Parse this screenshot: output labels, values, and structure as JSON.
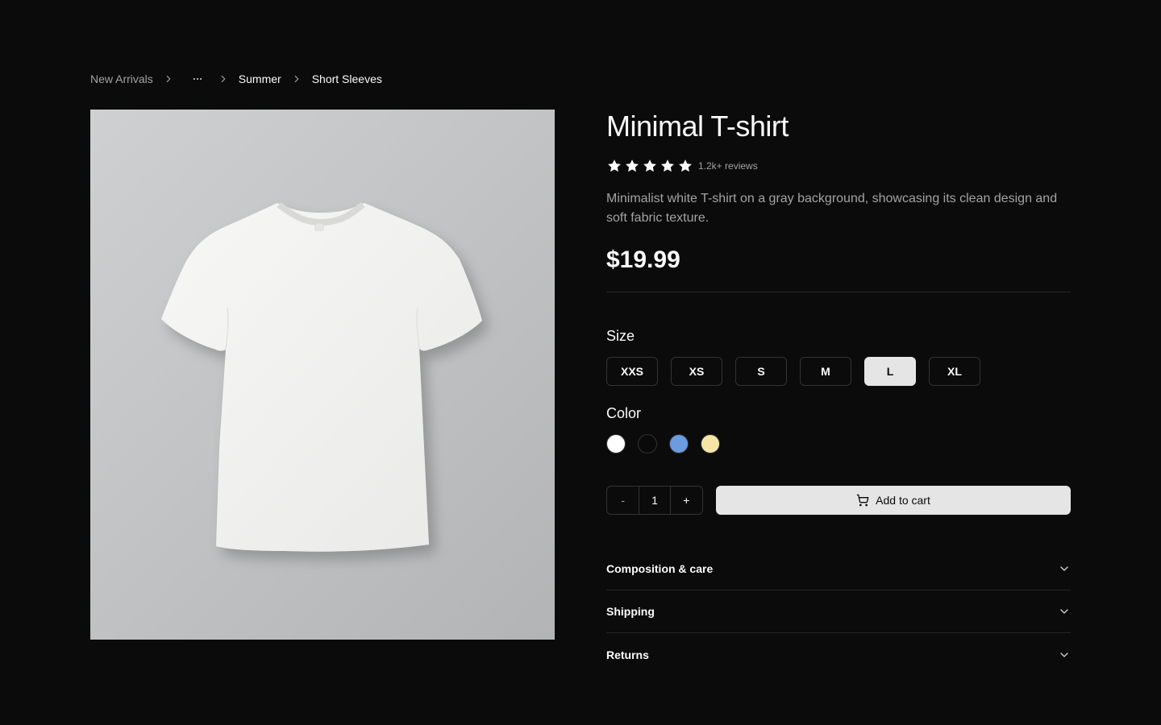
{
  "breadcrumb": {
    "items": [
      "New Arrivals",
      "Summer",
      "Short Sleeves"
    ],
    "ellipsis_icon": "more-horizontal-icon",
    "separator_icon": "chevron-right-icon"
  },
  "product": {
    "title": "Minimal T-shirt",
    "rating": 5,
    "rating_max": 5,
    "reviews": "1.2k+ reviews",
    "description": "Minimalist white T-shirt on a gray background, showcasing its clean design and soft fabric texture.",
    "price": "$19.99"
  },
  "size": {
    "label": "Size",
    "options": [
      "XXS",
      "XS",
      "S",
      "M",
      "L",
      "XL"
    ],
    "selected": "L"
  },
  "color": {
    "label": "Color",
    "options": [
      "#ffffff",
      "#0a0a0a",
      "#6b9be0",
      "#f5e6a8"
    ]
  },
  "cart": {
    "minus": "-",
    "quantity": "1",
    "plus": "+",
    "add_label": "Add to cart",
    "icon": "shopping-cart-icon"
  },
  "accordion": [
    "Composition & care",
    "Shipping",
    "Returns"
  ],
  "colors": {
    "background": "#0b0b0b",
    "text": "#fafafa",
    "muted": "#a3a3a3",
    "border": "#333333",
    "button": "#e5e5e5"
  }
}
